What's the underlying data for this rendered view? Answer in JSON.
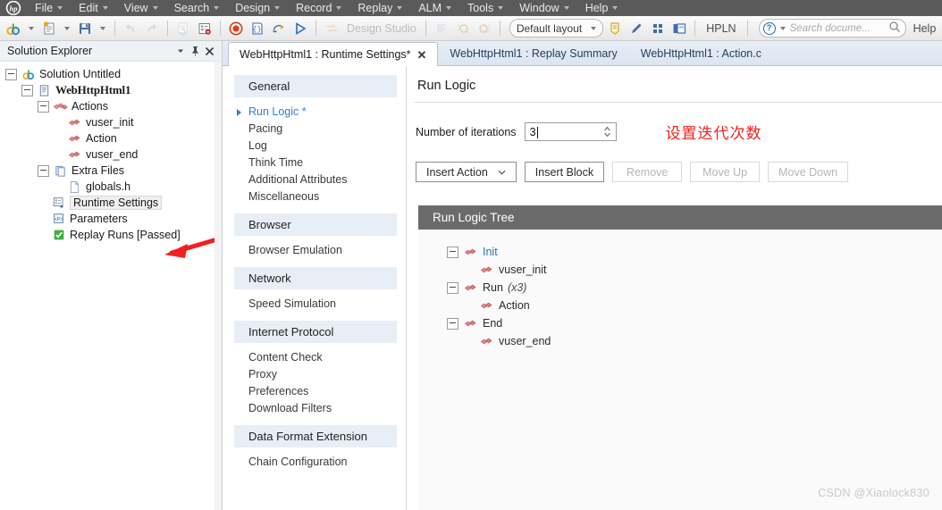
{
  "app": {
    "logo": "hp-logo",
    "menus": [
      {
        "label": "File"
      },
      {
        "label": "Edit"
      },
      {
        "label": "View"
      },
      {
        "label": "Search"
      },
      {
        "label": "Design"
      },
      {
        "label": "Record"
      },
      {
        "label": "Replay"
      },
      {
        "label": "ALM"
      },
      {
        "label": "Tools"
      },
      {
        "label": "Window"
      },
      {
        "label": "Help"
      }
    ]
  },
  "toolbar": {
    "layout_combo": "Default layout",
    "hpln_label": "HPLN",
    "design_studio_label": "Design Studio",
    "search_placeholder": "Search docume...",
    "help_label": "Help"
  },
  "solution_explorer": {
    "title": "Solution Explorer",
    "nodes": {
      "solution": "Solution Untitled",
      "script": "WebHttpHtml1",
      "actions": "Actions",
      "vuser_init": "vuser_init",
      "action": "Action",
      "vuser_end": "vuser_end",
      "extra_files": "Extra Files",
      "globals": "globals.h",
      "runtime_settings": "Runtime Settings",
      "parameters": "Parameters",
      "replay_runs": "Replay Runs [Passed]"
    }
  },
  "tabs": [
    {
      "label": "WebHttpHtml1 : Runtime Settings*",
      "active": true,
      "closable": true,
      "close": "✕"
    },
    {
      "label": "WebHttpHtml1 : Replay Summary",
      "active": false,
      "closable": false
    },
    {
      "label": "WebHttpHtml1 : Action.c",
      "active": false,
      "closable": false
    }
  ],
  "settings_nav": [
    {
      "type": "group",
      "label": "General"
    },
    {
      "type": "item",
      "label": "Run Logic *",
      "active": true
    },
    {
      "type": "item",
      "label": "Pacing",
      "active": false
    },
    {
      "type": "item",
      "label": "Log",
      "active": false
    },
    {
      "type": "item",
      "label": "Think Time",
      "active": false
    },
    {
      "type": "item",
      "label": "Additional Attributes",
      "active": false
    },
    {
      "type": "item",
      "label": "Miscellaneous",
      "active": false
    },
    {
      "type": "group",
      "label": "Browser"
    },
    {
      "type": "item",
      "label": "Browser Emulation",
      "active": false
    },
    {
      "type": "group",
      "label": "Network"
    },
    {
      "type": "item",
      "label": "Speed Simulation",
      "active": false
    },
    {
      "type": "group",
      "label": "Internet Protocol"
    },
    {
      "type": "item",
      "label": "Content Check",
      "active": false
    },
    {
      "type": "item",
      "label": "Proxy",
      "active": false
    },
    {
      "type": "item",
      "label": "Preferences",
      "active": false
    },
    {
      "type": "item",
      "label": "Download Filters",
      "active": false
    },
    {
      "type": "group",
      "label": "Data Format Extension"
    },
    {
      "type": "item",
      "label": "Chain Configuration",
      "active": false
    }
  ],
  "run_logic": {
    "title": "Run Logic",
    "iterations_label": "Number of iterations",
    "iterations_value": "3",
    "annotation": "设置迭代次数",
    "annotation_color": "#f02020",
    "buttons": [
      {
        "label": "Insert Action",
        "dropdown": true,
        "disabled": false,
        "chevron": "⌄"
      },
      {
        "label": "Insert Block",
        "dropdown": false,
        "disabled": false
      },
      {
        "label": "Remove",
        "dropdown": false,
        "disabled": true
      },
      {
        "label": "Move Up",
        "dropdown": false,
        "disabled": true
      },
      {
        "label": "Move Down",
        "dropdown": false,
        "disabled": true
      }
    ],
    "tree_title": "Run Logic Tree",
    "tree": [
      {
        "label": "Init",
        "level": 0,
        "expandable": true,
        "style": "blue",
        "multiplier": ""
      },
      {
        "label": "vuser_init",
        "level": 1,
        "expandable": false,
        "style": "dark",
        "multiplier": ""
      },
      {
        "label": "Run",
        "level": 0,
        "expandable": true,
        "style": "dark",
        "multiplier": "(x3)"
      },
      {
        "label": "Action",
        "level": 1,
        "expandable": false,
        "style": "dark",
        "multiplier": ""
      },
      {
        "label": "End",
        "level": 0,
        "expandable": true,
        "style": "dark",
        "multiplier": ""
      },
      {
        "label": "vuser_end",
        "level": 1,
        "expandable": false,
        "style": "dark",
        "multiplier": ""
      }
    ]
  },
  "watermark": "CSDN @Xiaolock830"
}
